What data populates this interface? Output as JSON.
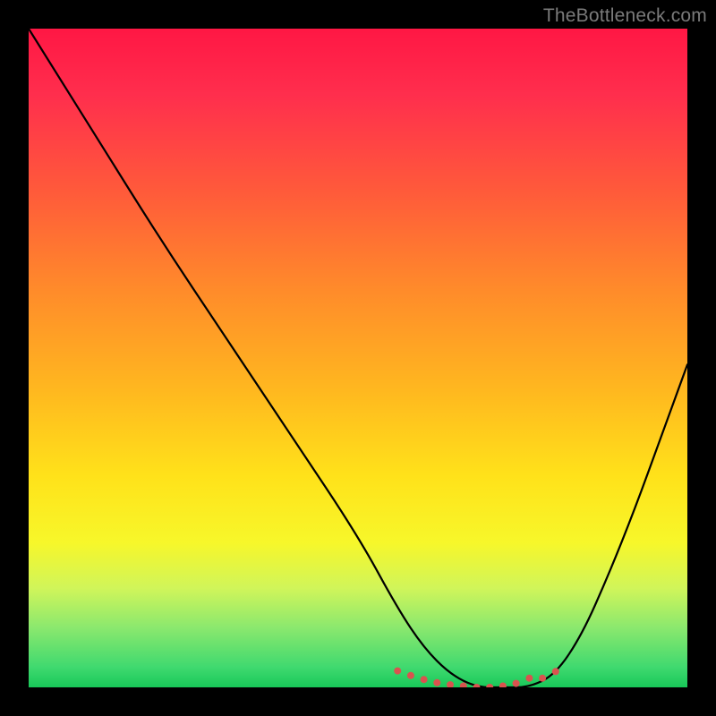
{
  "watermark": {
    "text": "TheBottleneck.com"
  },
  "chart_data": {
    "type": "line",
    "title": "",
    "xlabel": "",
    "ylabel": "",
    "xlim": [
      0,
      100
    ],
    "ylim": [
      0,
      100
    ],
    "background_gradient": {
      "orientation": "vertical",
      "stops": [
        {
          "pos": 0.0,
          "color": "#ff1744"
        },
        {
          "pos": 0.25,
          "color": "#ff5b3a"
        },
        {
          "pos": 0.55,
          "color": "#ffb81f"
        },
        {
          "pos": 0.78,
          "color": "#f7f72a"
        },
        {
          "pos": 0.97,
          "color": "#3fd96f"
        },
        {
          "pos": 1.0,
          "color": "#18c859"
        }
      ]
    },
    "series": [
      {
        "name": "curve",
        "color": "#000000",
        "x": [
          0,
          10,
          20,
          30,
          40,
          50,
          56,
          60,
          64,
          68,
          72,
          76,
          80,
          84,
          88,
          92,
          96,
          100
        ],
        "y": [
          100,
          84,
          68,
          53,
          38,
          23,
          12,
          6,
          2,
          0,
          0,
          0,
          2,
          8,
          17,
          27,
          38,
          49
        ]
      }
    ],
    "markers": {
      "name": "min-plateau",
      "color": "#d9534f",
      "radius": 4,
      "x": [
        56,
        58,
        60,
        62,
        64,
        66,
        68,
        70,
        72,
        74,
        76,
        78,
        80
      ],
      "y": [
        2.5,
        1.8,
        1.2,
        0.7,
        0.4,
        0.2,
        0.0,
        0.0,
        0.2,
        0.6,
        1.4,
        1.4,
        2.4
      ]
    }
  }
}
